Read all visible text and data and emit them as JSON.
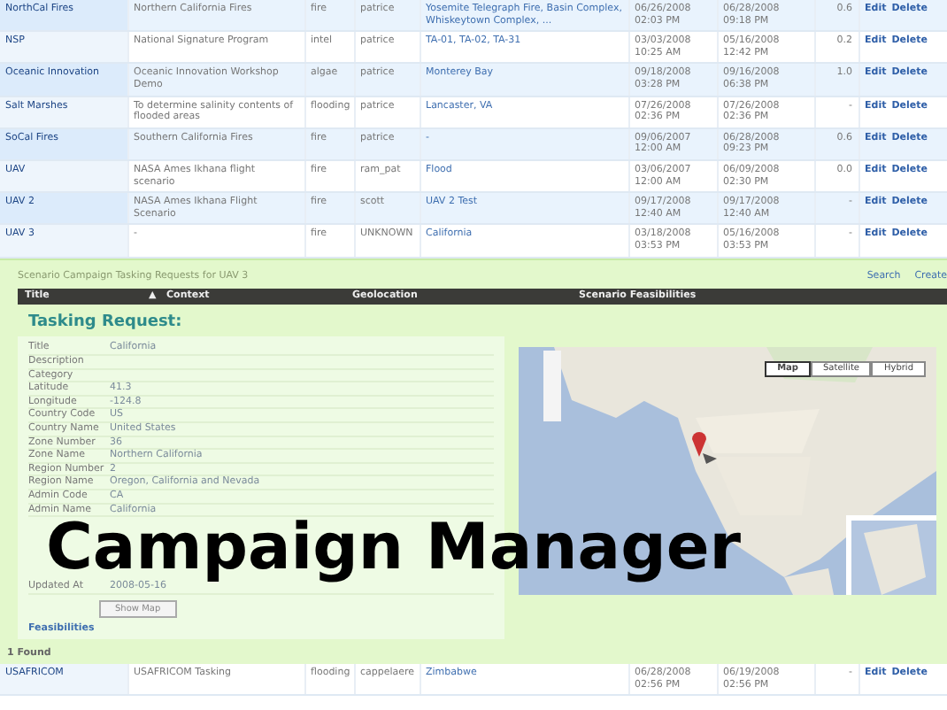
{
  "scenarios": [
    {
      "name": "NorthCal Fires",
      "description": "Northern California Fires",
      "category": "fire",
      "owner": "patrice",
      "location": "Yosemite Telegraph Fire, Basin Complex, Whiskeytown Complex, ...",
      "start": "06/26/2008 02:03 PM",
      "end": "06/28/2008 09:18 PM",
      "score": "0.6",
      "actions": [
        "Edit",
        "Delete"
      ]
    },
    {
      "name": "NSP",
      "description": "National Signature Program",
      "category": "intel",
      "owner": "patrice",
      "location": "TA-01, TA-02, TA-31",
      "start": "03/03/2008 10:25 AM",
      "end": "05/16/2008 12:42 PM",
      "score": "0.2",
      "actions": [
        "Edit",
        "Delete"
      ]
    },
    {
      "name": "Oceanic Innovation",
      "description": "Oceanic Innovation Workshop Demo",
      "category": "algae",
      "owner": "patrice",
      "location": "Monterey Bay",
      "start": "09/18/2008 03:28 PM",
      "end": "09/16/2008 06:38 PM",
      "score": "1.0",
      "actions": [
        "Edit",
        "Delete"
      ]
    },
    {
      "name": "Salt Marshes",
      "description": "To determine salinity contents of flooded areas",
      "category": "flooding",
      "owner": "patrice",
      "location": "Lancaster, VA",
      "start": "07/26/2008 02:36 PM",
      "end": "07/26/2008 02:36 PM",
      "score": "-",
      "actions": [
        "Edit",
        "Delete"
      ]
    },
    {
      "name": "SoCal Fires",
      "description": "Southern California Fires",
      "category": "fire",
      "owner": "patrice",
      "location": "-",
      "start": "09/06/2007 12:00 AM",
      "end": "06/28/2008 09:23 PM",
      "score": "0.6",
      "actions": [
        "Edit",
        "Delete"
      ]
    },
    {
      "name": "UAV",
      "description": "NASA Ames Ikhana flight scenario",
      "category": "fire",
      "owner": "ram_pat",
      "location": "Flood",
      "start": "03/06/2007 12:00 AM",
      "end": "06/09/2008 02:30 PM",
      "score": "0.0",
      "actions": [
        "Edit",
        "Delete"
      ]
    },
    {
      "name": "UAV 2",
      "description": "NASA Ames Ikhana Flight Scenario",
      "category": "fire",
      "owner": "scott",
      "location": "UAV 2 Test",
      "start": "09/17/2008 12:40 AM",
      "end": "09/17/2008 12:40 AM",
      "score": "-",
      "actions": [
        "Edit",
        "Delete"
      ]
    },
    {
      "name": "UAV 3",
      "description": "-",
      "category": "fire",
      "owner": "UNKNOWN",
      "location": "California",
      "start": "03/18/2008 03:53 PM",
      "end": "05/16/2008 03:53 PM",
      "score": "-",
      "actions": [
        "Edit",
        "Delete"
      ]
    }
  ],
  "panel": {
    "title": "Scenario Campaign Tasking Requests for UAV 3",
    "links": [
      "Search",
      "Create"
    ],
    "columns": [
      "Title",
      "▲",
      "Context",
      "Geolocation",
      "Scenario Feasibilities"
    ],
    "heading": "Tasking Request:",
    "details": [
      {
        "label": "Title",
        "value": "California"
      },
      {
        "label": "Description"
      },
      {
        "label": "Category"
      },
      {
        "label": "Latitude",
        "value": "41.3"
      },
      {
        "label": "Longitude",
        "value": "-124.8"
      },
      {
        "label": "Country Code",
        "value": "US"
      },
      {
        "label": "Country Name",
        "value": "United States"
      },
      {
        "label": "Zone Number",
        "value": "36"
      },
      {
        "label": "Zone Name",
        "value": "Northern California"
      },
      {
        "label": "Region Number",
        "value": "2"
      },
      {
        "label": "Region Name",
        "value": "Oregon, California and Nevada"
      },
      {
        "label": "Admin Code",
        "value": "CA"
      },
      {
        "label": "Admin Name",
        "value": "California"
      }
    ],
    "updated": {
      "label": "Updated At",
      "value": "2008-05-16"
    },
    "show_map": "Show Map",
    "feasibilities": "Feasibilities",
    "map_types": [
      {
        "label": "Map",
        "selected": true
      },
      {
        "label": "Satellite",
        "selected": false
      },
      {
        "label": "Hybrid",
        "selected": false
      }
    ]
  },
  "found": "1 Found",
  "last_row": {
    "name": "USAFRICOM",
    "description": "USAFRICOM Tasking",
    "category": "flooding",
    "owner": "cappelaere",
    "location": "Zimbabwe",
    "start": "06/28/2008 02:56 PM",
    "end": "06/19/2008 02:56 PM",
    "score": "-",
    "actions": [
      "Edit",
      "Delete"
    ]
  },
  "caption": "Campaign Manager"
}
